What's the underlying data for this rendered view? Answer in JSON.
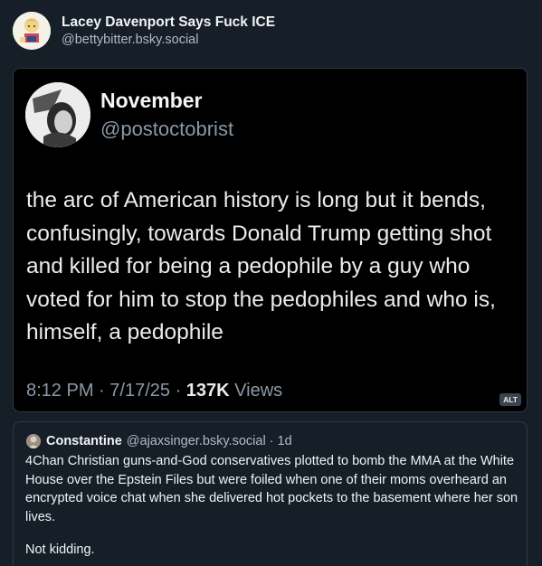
{
  "post": {
    "author_name": "Lacey Davenport Says Fuck ICE",
    "author_handle": "@bettybitter.bsky.social"
  },
  "embedded_tweet": {
    "name": "November",
    "handle": "@postoctobrist",
    "text": "the arc of American history is long but it bends, confusingly, towards Donald Trump getting shot and killed for being a pedophile by a guy who voted for him to stop the pedophiles and who is, himself, a pedophile",
    "time": "8:12 PM",
    "date": "7/17/25",
    "views_count": "137K",
    "views_label": "Views",
    "alt_badge": "ALT"
  },
  "quote": {
    "name": "Constantine",
    "handle": "@ajaxsinger.bsky.social",
    "separator": "·",
    "time": "1d",
    "text": "4Chan Christian guns-and-God conservatives plotted to bomb the MMA at the White House over the Epstein Files but were foiled when one of their moms overheard an encrypted voice chat when she delivered hot pockets to the basement where her son lives.",
    "text2": "Not kidding."
  }
}
